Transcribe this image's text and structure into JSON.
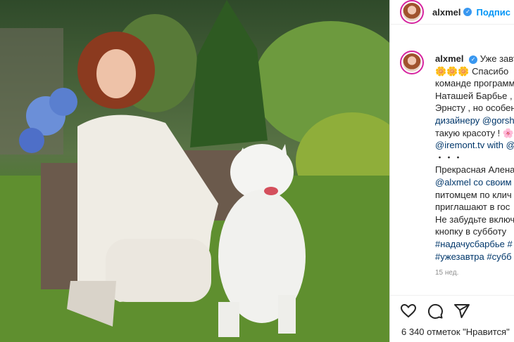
{
  "post": {
    "username": "alxmel",
    "follow_label": "Подпис",
    "caption_lines": [
      "Уже завт",
      "🌼🌼🌼 Спасибо",
      "команде программ",
      "Наташей Барбье ,",
      "Эрнсту , но особен",
      "дизайнеру @gorsh",
      "такую красоту ! 🌸",
      "@iremont.tv with @",
      "・・・",
      "Прекрасная Алена",
      "@alxmel со своим",
      "питомцем по клич",
      "приглашают в гос",
      "Не забудьте включ",
      "кнопку в субботу",
      "#надачусбарбье #",
      "#ужезавтра #субб"
    ],
    "time": "15 нед.",
    "likes_text": "6 340 отметок \"Нравится\""
  },
  "icons": {
    "like": "heart-icon",
    "comment": "comment-icon",
    "share": "share-icon",
    "verified": "verified-icon"
  },
  "colors": {
    "accent": "#0095f6",
    "link": "#00376b",
    "muted": "#8e8e8e"
  }
}
